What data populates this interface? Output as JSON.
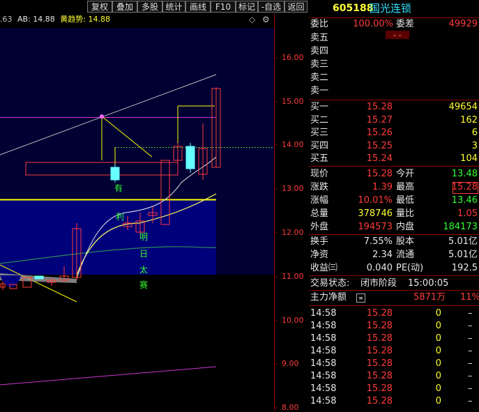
{
  "toolbar": [
    "复权",
    "叠加",
    "多股",
    "统计",
    "画线",
    "F10",
    "标记",
    "-自选",
    "返回"
  ],
  "indicator": {
    "prefix": ".63",
    "ab_label": "AB: 14.88",
    "trend_label": "黄趋势: 14.88"
  },
  "icons": {
    "diamond": "◇",
    "settings": "⚙"
  },
  "price_axis": [
    "16.00",
    "15.00",
    "14.00",
    "13.00",
    "12.00",
    "11.00",
    "10.00",
    "9.00",
    "8.00"
  ],
  "chart_labels": {
    "you": "有",
    "li": "利",
    "ming": "明",
    "ri": "日",
    "tai": "太",
    "sai": "赛"
  },
  "stock": {
    "code": "605188",
    "name": "国光连锁"
  },
  "ratio": {
    "label1": "委比",
    "value1": "100.00%",
    "label2": "委差",
    "value2": "49929"
  },
  "sell": [
    {
      "label": "卖五",
      "price": "",
      "vol": ""
    },
    {
      "label": "卖四",
      "price": "",
      "vol": ""
    },
    {
      "label": "卖三",
      "price": "",
      "vol": ""
    },
    {
      "label": "卖二",
      "price": "",
      "vol": ""
    },
    {
      "label": "卖一",
      "price": "",
      "vol": ""
    }
  ],
  "buy": [
    {
      "label": "买一",
      "price": "15.28",
      "vol": "49654"
    },
    {
      "label": "买二",
      "price": "15.27",
      "vol": "162"
    },
    {
      "label": "买三",
      "price": "15.26",
      "vol": "6"
    },
    {
      "label": "买四",
      "price": "15.25",
      "vol": "3"
    },
    {
      "label": "买五",
      "price": "15.24",
      "vol": "104"
    }
  ],
  "quote": [
    {
      "l1": "现价",
      "v1": "15.28",
      "c1": "red",
      "l2": "今开",
      "v2": "13.48",
      "c2": "green"
    },
    {
      "l1": "涨跌",
      "v1": "1.39",
      "c1": "red",
      "l2": "最高",
      "v2": "15.28",
      "c2": "red"
    },
    {
      "l1": "涨幅",
      "v1": "10.01%",
      "c1": "red",
      "l2": "最低",
      "v2": "13.46",
      "c2": "green"
    },
    {
      "l1": "总量",
      "v1": "378746",
      "c1": "yel",
      "l2": "量比",
      "v2": "1.05",
      "c2": "red"
    },
    {
      "l1": "外盘",
      "v1": "194573",
      "c1": "red",
      "l2": "内盘",
      "v2": "184173",
      "c2": "green"
    }
  ],
  "stats": [
    {
      "l1": "换手",
      "v1": "7.55%",
      "l2": "股本",
      "v2": "5.01亿"
    },
    {
      "l1": "净资",
      "v1": "2.34",
      "l2": "流通",
      "v2": "5.01亿"
    },
    {
      "l1": "收益㈢",
      "v1": "0.040",
      "l2": "PE(动)",
      "v2": "192.5"
    }
  ],
  "status": {
    "label": "交易状态:",
    "value": "闭市阶段",
    "time": "15:00:05"
  },
  "main_flow": {
    "label": "主力净额",
    "value": "5871万",
    "pct": "11%"
  },
  "ticks": [
    {
      "time": "14:58",
      "price": "15.28",
      "vol": "0",
      "dir": "–"
    },
    {
      "time": "14:58",
      "price": "15.28",
      "vol": "0",
      "dir": "–"
    },
    {
      "time": "14:58",
      "price": "15.28",
      "vol": "0",
      "dir": "–"
    },
    {
      "time": "14:58",
      "price": "15.28",
      "vol": "0",
      "dir": "–"
    },
    {
      "time": "14:58",
      "price": "15.28",
      "vol": "0",
      "dir": "–"
    },
    {
      "time": "14:58",
      "price": "15.28",
      "vol": "0",
      "dir": "–"
    },
    {
      "time": "14:58",
      "price": "15.28",
      "vol": "0",
      "dir": "–"
    },
    {
      "time": "14:58",
      "price": "15.28",
      "vol": "0",
      "dir": "–"
    }
  ]
}
